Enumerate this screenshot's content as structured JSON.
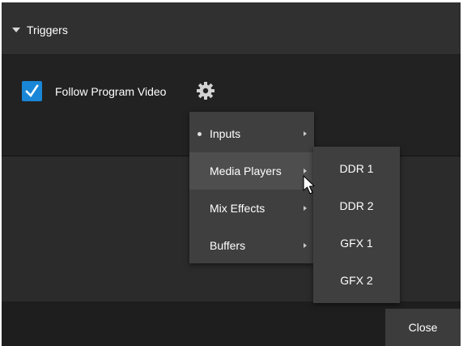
{
  "header": {
    "title": "Triggers",
    "expand_icon": "triangle-down-icon"
  },
  "trigger": {
    "checked": true,
    "label": "Follow Program Video",
    "settings_icon": "gear-icon"
  },
  "menu": {
    "items": [
      {
        "label": "Inputs",
        "selected": true,
        "highlighted": false,
        "has_submenu": true
      },
      {
        "label": "Media Players",
        "selected": false,
        "highlighted": true,
        "has_submenu": true
      },
      {
        "label": "Mix Effects",
        "selected": false,
        "highlighted": false,
        "has_submenu": true
      },
      {
        "label": "Buffers",
        "selected": false,
        "highlighted": false,
        "has_submenu": true
      }
    ]
  },
  "submenu": {
    "items": [
      "DDR 1",
      "DDR 2",
      "GFX 1",
      "GFX 2"
    ]
  },
  "footer": {
    "close_label": "Close"
  },
  "colors": {
    "accent": "#1a86d7",
    "panel": "#2b2b2b",
    "menu": "#3f3f3f",
    "menu_highlight": "#4e4e4e"
  }
}
